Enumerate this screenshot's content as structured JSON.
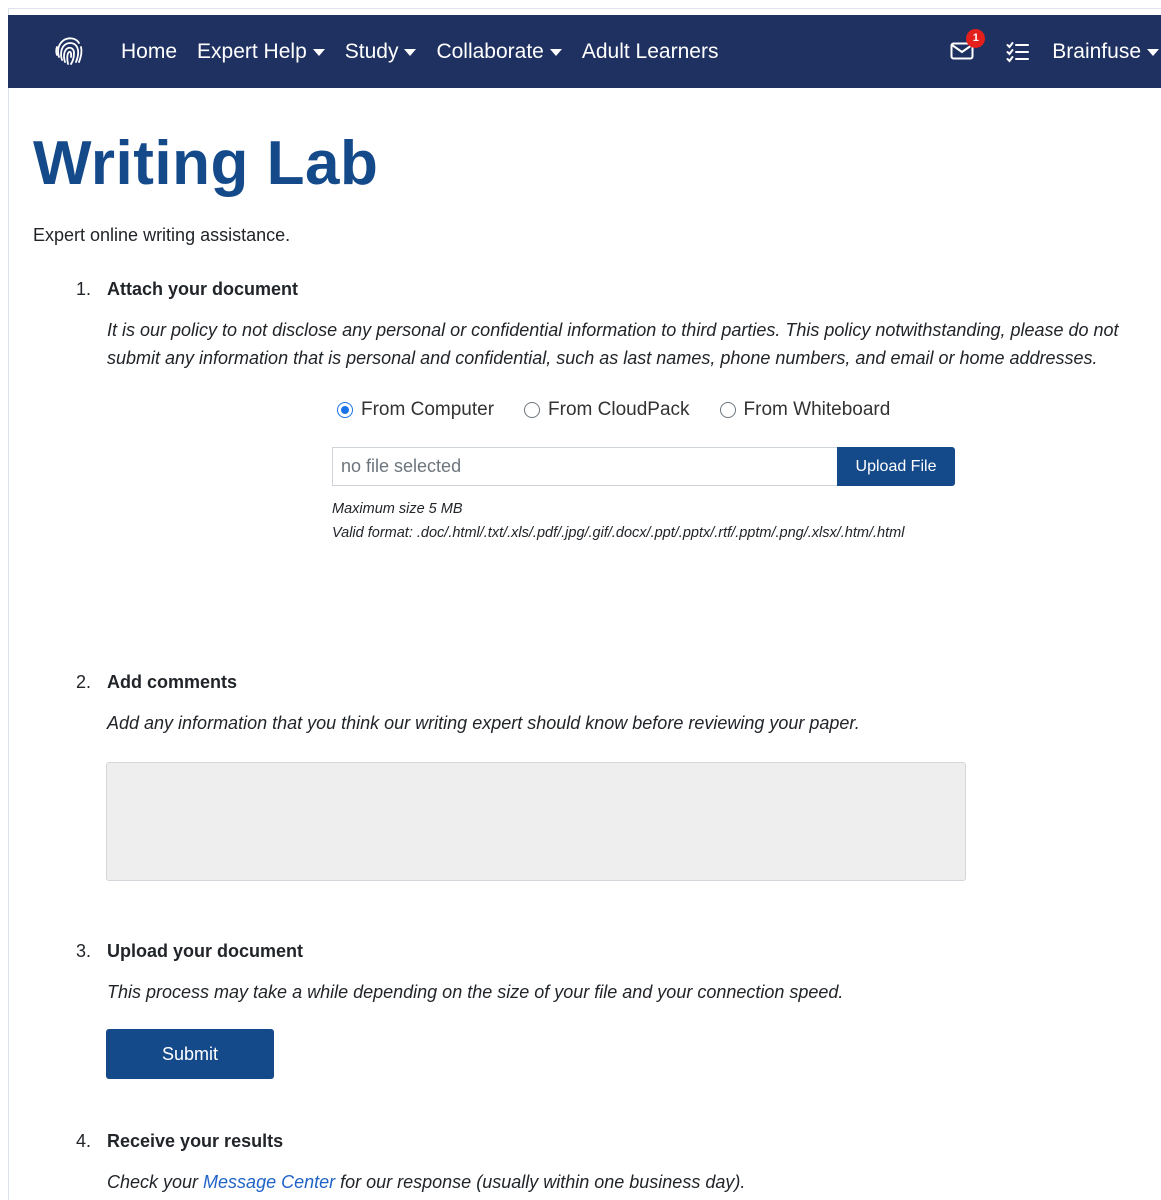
{
  "nav": {
    "items": [
      {
        "label": "Home",
        "dropdown": false
      },
      {
        "label": "Expert Help",
        "dropdown": true
      },
      {
        "label": "Study",
        "dropdown": true
      },
      {
        "label": "Collaborate",
        "dropdown": true
      },
      {
        "label": "Adult Learners",
        "dropdown": false
      }
    ],
    "mail_badge": "1",
    "user_label": "Brainfuse"
  },
  "page": {
    "title": "Writing Lab",
    "subtitle": "Expert online writing assistance."
  },
  "step1": {
    "num": "1.",
    "title": "Attach your document",
    "desc": "It is our policy to not disclose any personal or confidential information to third parties. This policy notwithstanding, please do not submit any information that is personal and confidential, such as last names, phone numbers, and email or home addresses.",
    "radios": [
      {
        "label": "From Computer",
        "checked": true
      },
      {
        "label": "From CloudPack",
        "checked": false
      },
      {
        "label": "From Whiteboard",
        "checked": false
      }
    ],
    "file_placeholder": "no file selected",
    "upload_label": "Upload File",
    "max_size": "Maximum size 5 MB",
    "valid_format": "Valid format:  .doc/.html/.txt/.xls/.pdf/.jpg/.gif/.docx/.ppt/.pptx/.rtf/.pptm/.png/.xlsx/.htm/.html"
  },
  "step2": {
    "num": "2.",
    "title": "Add comments",
    "desc": "Add any information that you think our writing expert should know before reviewing your paper.",
    "comments_value": ""
  },
  "step3": {
    "num": "3.",
    "title": "Upload your document",
    "desc": "This process may take a while depending on the size of your file and your connection speed.",
    "submit_label": "Submit"
  },
  "step4": {
    "num": "4.",
    "title": "Receive your results",
    "desc_before": "Check your ",
    "link": "Message Center",
    "desc_after": " for our response (usually within one business day)."
  },
  "colors": {
    "navbar": "#1f3160",
    "primary": "#154a8a",
    "badge": "#e3201b",
    "link": "#1f63c6"
  }
}
